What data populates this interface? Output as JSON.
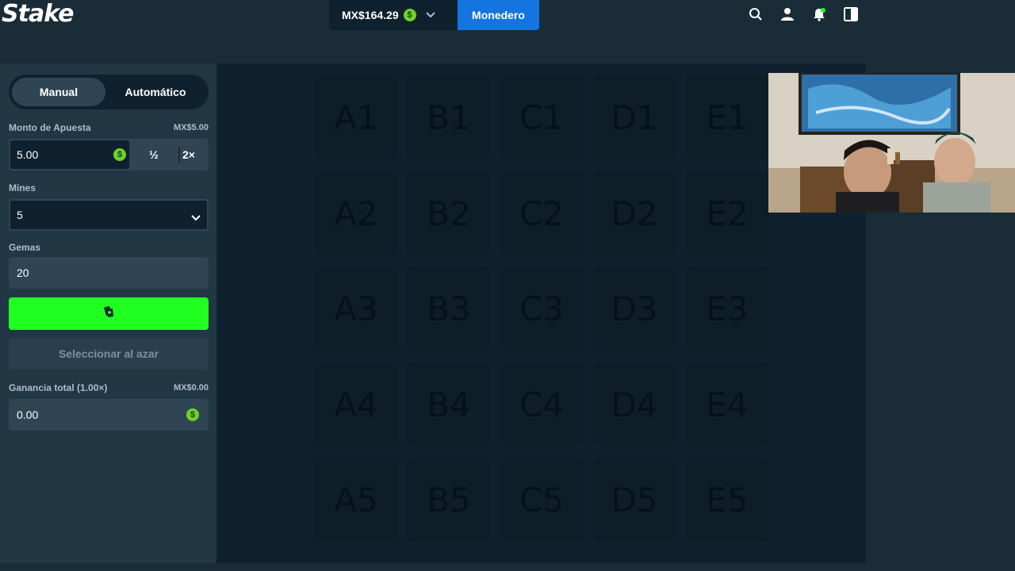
{
  "header": {
    "logo": "Stake",
    "balance": "MX$164.29",
    "currency_symbol": "$",
    "wallet_label": "Monedero"
  },
  "sidebar": {
    "tabs": [
      {
        "label": "Manual",
        "active": true
      },
      {
        "label": "Automático",
        "active": false
      }
    ],
    "bet_amount": {
      "label": "Monto de Apuesta",
      "converted": "MX$5.00",
      "value": "5.00",
      "half_label": "½",
      "double_label": "2×"
    },
    "mines": {
      "label": "Mines",
      "value": "5"
    },
    "gems": {
      "label": "Gemas",
      "value": "20"
    },
    "random_label": "Seleccionar al azar",
    "profit": {
      "label": "Ganancia total (1.00×)",
      "converted": "MX$0.00",
      "value": "0.00"
    }
  },
  "grid": {
    "tiles": [
      "A1",
      "B1",
      "C1",
      "D1",
      "E1",
      "A2",
      "B2",
      "C2",
      "D2",
      "E2",
      "A3",
      "B3",
      "C3",
      "D3",
      "E3",
      "A4",
      "B4",
      "C4",
      "D4",
      "E4",
      "A5",
      "B5",
      "C5",
      "D5",
      "E5"
    ]
  },
  "colors": {
    "background": "#1a2c38",
    "sidebar": "#213743",
    "bet_button": "#1fff20",
    "wallet_button": "#1475e1",
    "coin": "#6fd12a"
  },
  "icons": {
    "search": "search-icon",
    "user": "user-icon",
    "notifications": "bell-icon",
    "sidebar_toggle": "panel-icon",
    "bet": "cards-icon"
  }
}
